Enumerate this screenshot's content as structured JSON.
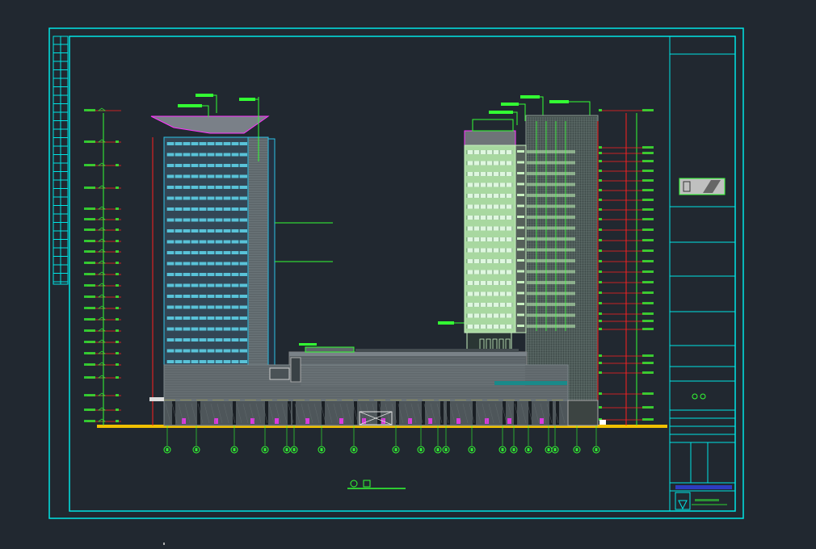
{
  "viewport": {
    "background": "#212830"
  },
  "colors": {
    "frame": "#00e5e5",
    "building_left": "#2cc2e6",
    "building_right_light": "#c8f0c0",
    "mesh": "#7a8a80",
    "podium": "#6c7478",
    "ground": "#f0c000",
    "red_lines": "#ff2020",
    "green_marks": "#33ff33",
    "magenta": "#ff33ff",
    "yellow": "#e8d000"
  },
  "icons": {
    "north_logo": "triangle-logo-icon",
    "section_marker": "section-marker-icon"
  },
  "drawing": {
    "left_levels": [
      "1",
      "2",
      "3",
      "4",
      "5",
      "6",
      "7",
      "8",
      "9",
      "10",
      "11",
      "12",
      "13",
      "14",
      "15",
      "16",
      "17",
      "18",
      "19",
      "20",
      "21"
    ],
    "right_levels": [
      "1",
      "2",
      "3",
      "4",
      "5",
      "6",
      "7",
      "8",
      "9",
      "10",
      "11",
      "12",
      "13",
      "14",
      "15",
      "16",
      "17",
      "18",
      "19",
      "20",
      "21"
    ],
    "axis_labels": [
      "1",
      "2",
      "3",
      "4",
      "5",
      "6",
      "7",
      "8",
      "9",
      "10",
      "11",
      "12",
      "13",
      "14",
      "15",
      "16",
      "17",
      "18",
      "19",
      "20",
      "21"
    ]
  }
}
